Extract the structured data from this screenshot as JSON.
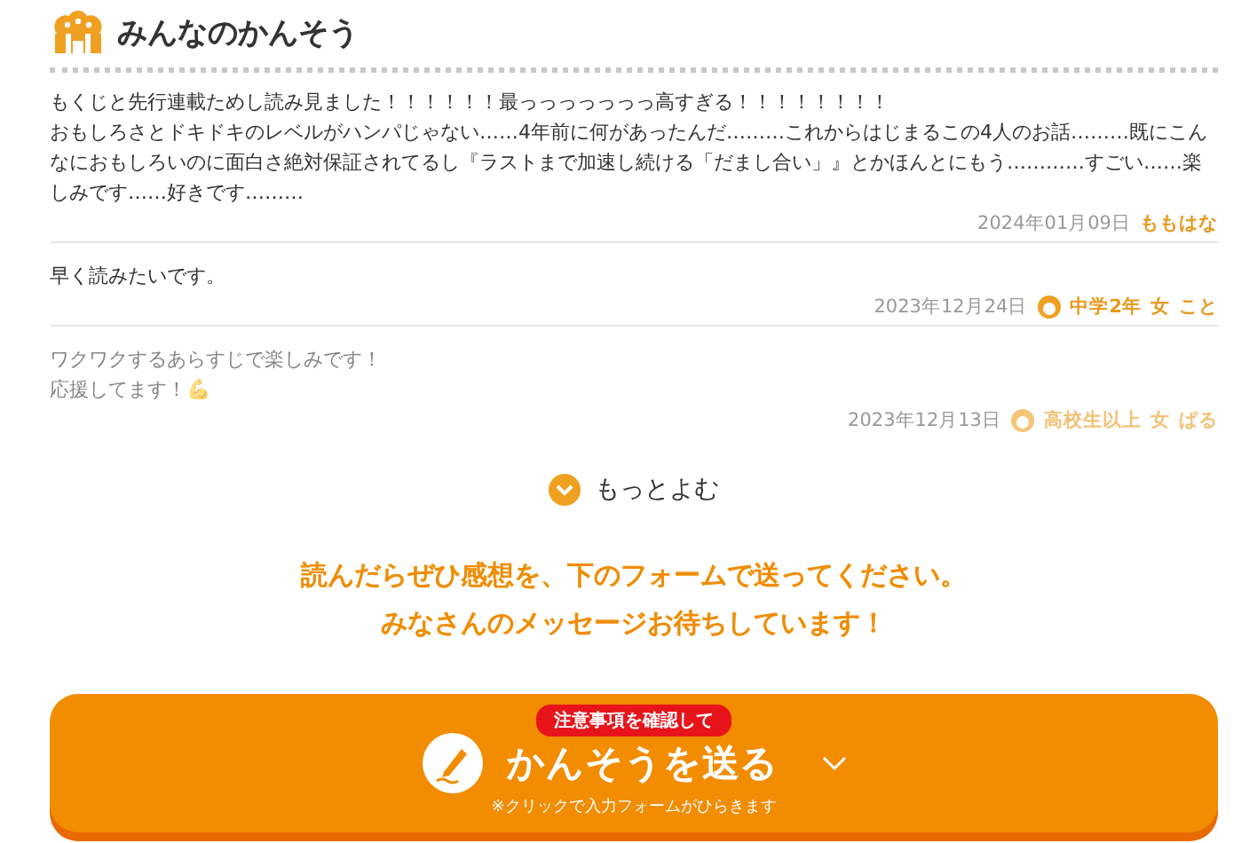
{
  "section": {
    "title": "みんなのかんそう"
  },
  "comments": [
    {
      "lines": [
        "もくじと先行連載ためし読み見ました！！！！！！最っっっっっっっ高すぎる！！！！！！！！",
        "おもしろさとドキドキのレベルがハンパじゃない……4年前に何があったんだ………これからはじまるこの4人のお話………既にこんなにおもしろいのに面白さ絶対保証されてるし『ラストまで加速し続ける「だまし合い」』とかほんとにもう…………すごい……楽しみです……好きです………"
      ],
      "date": "2024年01月09日",
      "author": "ももはな",
      "faded": false
    },
    {
      "lines": [
        "早く読みたいです。"
      ],
      "date": "2023年12月24日",
      "grade": "中学2年",
      "gender": "女",
      "author": "こと",
      "faded": false
    },
    {
      "lines": [
        "ワクワクするあらすじで楽しみです！",
        "応援してます！"
      ],
      "emoji": "💪",
      "date": "2023年12月13日",
      "grade": "高校生以上",
      "gender": "女",
      "author": "ぱる",
      "faded": true
    }
  ],
  "more_button": {
    "label": "もっとよむ"
  },
  "invite": [
    "読んだらぜひ感想を、下のフォームで送ってください。",
    "みなさんのメッセージお待ちしています！"
  ],
  "send_button": {
    "badge": "注意事項を確認して",
    "label": "かんそうを送る",
    "note": "※クリックで入力フォームがひらきます"
  }
}
